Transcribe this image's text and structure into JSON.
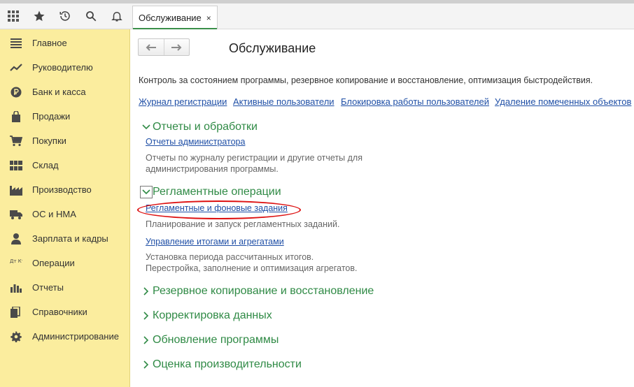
{
  "toolbar": {
    "buttons": [
      {
        "icon": "apps-grid-icon"
      },
      {
        "icon": "star-icon"
      },
      {
        "icon": "history-icon"
      },
      {
        "icon": "search-icon"
      },
      {
        "icon": "bell-icon"
      }
    ]
  },
  "tab": {
    "label": "Обслуживание",
    "close": "×"
  },
  "sidebar": {
    "items": [
      {
        "label": "Главное",
        "icon": "menu-lines-icon"
      },
      {
        "label": "Руководителю",
        "icon": "trend-chart-icon"
      },
      {
        "label": "Банк и касса",
        "icon": "ruble-coin-icon"
      },
      {
        "label": "Продажи",
        "icon": "shopping-bag-icon"
      },
      {
        "label": "Покупки",
        "icon": "cart-icon"
      },
      {
        "label": "Склад",
        "icon": "warehouse-grid-icon"
      },
      {
        "label": "Производство",
        "icon": "factory-icon"
      },
      {
        "label": "ОС и НМА",
        "icon": "truck-icon"
      },
      {
        "label": "Зарплата и кадры",
        "icon": "person-icon"
      },
      {
        "label": "Операции",
        "icon": "dt-kt-icon",
        "icon_text": "Дт Кт"
      },
      {
        "label": "Отчеты",
        "icon": "bar-chart-icon"
      },
      {
        "label": "Справочники",
        "icon": "books-icon"
      },
      {
        "label": "Администрирование",
        "icon": "gear-icon"
      }
    ]
  },
  "main": {
    "title": "Обслуживание",
    "description": "Контроль за состоянием программы, резервное копирование и восстановление, оптимизация быстродействия.",
    "links": [
      "Журнал регистрации",
      "Активные пользователи",
      "Блокировка работы пользователей",
      "Удаление помеченных объектов"
    ],
    "sections": {
      "reports": {
        "title": "Отчеты и обработки",
        "link": "Отчеты администратора",
        "desc_line1": "Отчеты по журналу регистрации и другие отчеты для",
        "desc_line2": "администрирования программы."
      },
      "routine": {
        "title": "Регламентные операции",
        "link1": "Регламентные и фоновые задания",
        "desc1": "Планирование и запуск регламентных заданий.",
        "link2": "Управление итогами и агрегатами",
        "desc2_line1": "Установка периода рассчитанных итогов.",
        "desc2_line2": "Перестройка, заполнение и оптимизация агрегатов."
      },
      "backup": {
        "title": "Резервное копирование и восстановление"
      },
      "correction": {
        "title": "Корректировка данных"
      },
      "update": {
        "title": "Обновление программы"
      },
      "performance": {
        "title": "Оценка производительности"
      }
    }
  },
  "colors": {
    "sidebar_bg": "#fbed9e",
    "section_green": "#2f8a45",
    "link_blue": "#1f4fa6",
    "highlight_red": "#dd1111"
  }
}
